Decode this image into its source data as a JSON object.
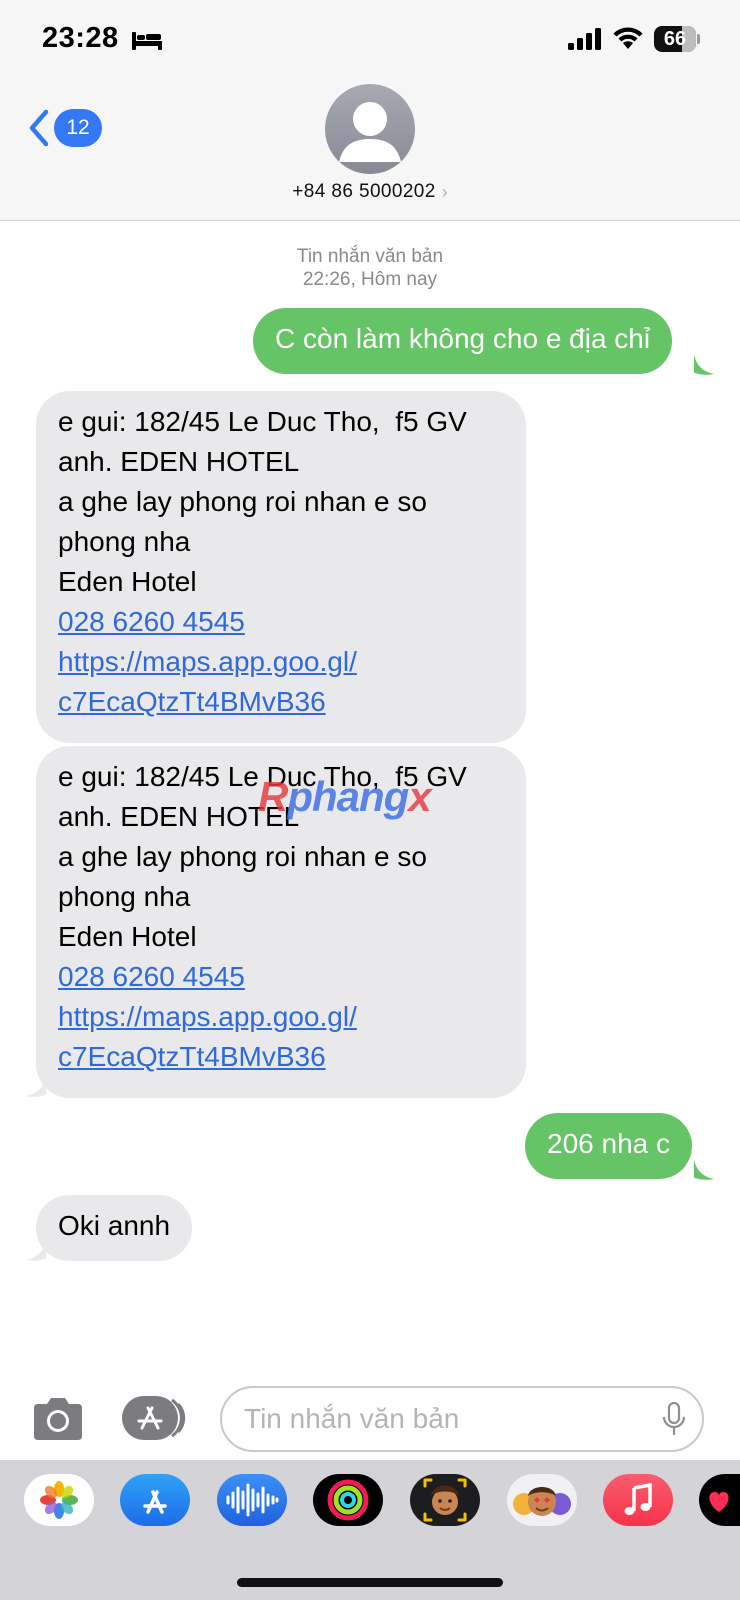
{
  "status_bar": {
    "time": "23:28",
    "focus_icon": "bed-icon",
    "battery_level": "66",
    "signal_icon": "cellular-signal-icon",
    "wifi_icon": "wifi-icon"
  },
  "header": {
    "back_badge_count": "12",
    "contact_name": "+84 86 5000202",
    "contact_chevron": "›"
  },
  "conversation": {
    "timestamp_line1": "Tin nhắn văn bản",
    "timestamp_line2": "22:26, Hôm nay",
    "messages": [
      {
        "direction": "sent",
        "text": "C còn làm không cho e địa chỉ"
      },
      {
        "direction": "received",
        "lines": [
          "e gui: 182/45 Le Duc Tho,  f5 GV",
          "anh. EDEN HOTEL",
          "a ghe lay phong roi nhan e so",
          "phong nha",
          "Eden Hotel"
        ],
        "phone_link": "028 6260 4545",
        "url_line1": "https://maps.app.goo.gl/",
        "url_line2": "c7EcaQtzTt4BMvB36"
      },
      {
        "direction": "received",
        "lines": [
          "e gui: 182/45 Le Duc Tho,  f5 GV",
          "anh. EDEN HOTEL",
          "a ghe lay phong roi nhan e so",
          "phong nha",
          "Eden Hotel"
        ],
        "phone_link": "028 6260 4545",
        "url_line1": "https://maps.app.goo.gl/",
        "url_line2": "c7EcaQtzTt4BMvB36"
      },
      {
        "direction": "sent",
        "text": "206 nha c"
      },
      {
        "direction": "received",
        "text": "Oki annh"
      }
    ]
  },
  "watermark": {
    "part1": "R",
    "part2": "phang",
    "part3": "x"
  },
  "input": {
    "placeholder": "Tin nhắn văn bản",
    "value": ""
  },
  "app_drawer": {
    "apps": [
      "photos-icon",
      "app-store-icon",
      "audio-message-icon",
      "activity-icon",
      "memoji-icon",
      "animoji-icon",
      "music-icon",
      "digital-touch-icon"
    ]
  },
  "colors": {
    "sent_bubble": "#65c466",
    "received_bubble": "#e9e9eb",
    "link": "#2f6ad8",
    "accent_blue": "#3478f6"
  }
}
